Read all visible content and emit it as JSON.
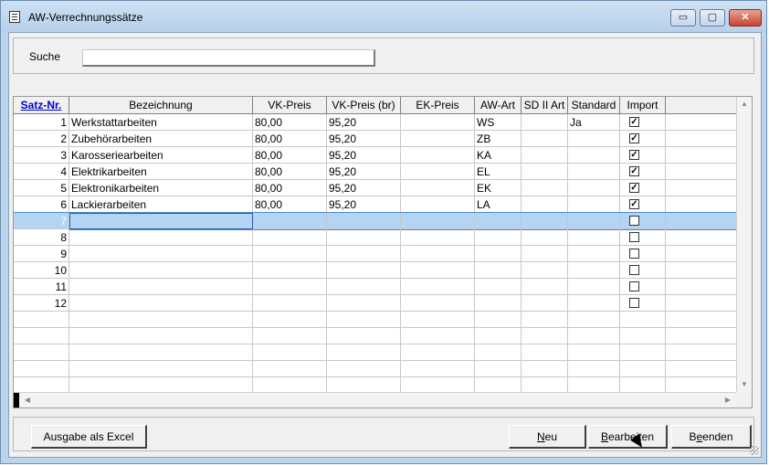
{
  "window": {
    "title": "AW-Verrechnungssätze"
  },
  "window_controls": {
    "minimize": "▭",
    "maximize": "▢",
    "close": "✕"
  },
  "search": {
    "label": "Suche",
    "value": "",
    "placeholder": ""
  },
  "grid": {
    "columns": [
      {
        "label": "Satz-Nr."
      },
      {
        "label": "Bezeichnung"
      },
      {
        "label": "VK-Preis"
      },
      {
        "label": "VK-Preis (br)"
      },
      {
        "label": "EK-Preis"
      },
      {
        "label": "AW-Art"
      },
      {
        "label": "SD II Art"
      },
      {
        "label": "Standard"
      },
      {
        "label": "Import"
      }
    ],
    "rows": [
      {
        "nr": "1",
        "bezeichnung": "Werkstattarbeiten",
        "vk": "80,00",
        "vkbr": "95,20",
        "ek": "",
        "aw": "WS",
        "sd": "",
        "std": "Ja",
        "import": true
      },
      {
        "nr": "2",
        "bezeichnung": "Zubehörarbeiten",
        "vk": "80,00",
        "vkbr": "95,20",
        "ek": "",
        "aw": "ZB",
        "sd": "",
        "std": "",
        "import": true
      },
      {
        "nr": "3",
        "bezeichnung": "Karosseriearbeiten",
        "vk": "80,00",
        "vkbr": "95,20",
        "ek": "",
        "aw": "KA",
        "sd": "",
        "std": "",
        "import": true
      },
      {
        "nr": "4",
        "bezeichnung": "Elektrikarbeiten",
        "vk": "80,00",
        "vkbr": "95,20",
        "ek": "",
        "aw": "EL",
        "sd": "",
        "std": "",
        "import": true
      },
      {
        "nr": "5",
        "bezeichnung": "Elektronikarbeiten",
        "vk": "80,00",
        "vkbr": "95,20",
        "ek": "",
        "aw": "EK",
        "sd": "",
        "std": "",
        "import": true
      },
      {
        "nr": "6",
        "bezeichnung": "Lackierarbeiten",
        "vk": "80,00",
        "vkbr": "95,20",
        "ek": "",
        "aw": "LA",
        "sd": "",
        "std": "",
        "import": true
      },
      {
        "nr": "7",
        "bezeichnung": "",
        "vk": "",
        "vkbr": "",
        "ek": "",
        "aw": "",
        "sd": "",
        "std": "",
        "import": false,
        "selected": true
      },
      {
        "nr": "8",
        "bezeichnung": "",
        "vk": "",
        "vkbr": "",
        "ek": "",
        "aw": "",
        "sd": "",
        "std": "",
        "import": false
      },
      {
        "nr": "9",
        "bezeichnung": "",
        "vk": "",
        "vkbr": "",
        "ek": "",
        "aw": "",
        "sd": "",
        "std": "",
        "import": false
      },
      {
        "nr": "10",
        "bezeichnung": "",
        "vk": "",
        "vkbr": "",
        "ek": "",
        "aw": "",
        "sd": "",
        "std": "",
        "import": false
      },
      {
        "nr": "11",
        "bezeichnung": "",
        "vk": "",
        "vkbr": "",
        "ek": "",
        "aw": "",
        "sd": "",
        "std": "",
        "import": false
      },
      {
        "nr": "12",
        "bezeichnung": "",
        "vk": "",
        "vkbr": "",
        "ek": "",
        "aw": "",
        "sd": "",
        "std": "",
        "import": false
      }
    ],
    "checkmark": "✓"
  },
  "buttons": {
    "excel": {
      "pre": "Aus",
      "u": "g",
      "post": "abe als Excel"
    },
    "neu": {
      "pre": "",
      "u": "N",
      "post": "eu"
    },
    "bearbeiten": {
      "pre": "",
      "u": "B",
      "post": "earbeiten"
    },
    "beenden": {
      "pre": "B",
      "u": "e",
      "post": "enden"
    }
  },
  "scroll": {
    "up": "▲",
    "down": "▼",
    "left": "◀",
    "right": "▶"
  }
}
